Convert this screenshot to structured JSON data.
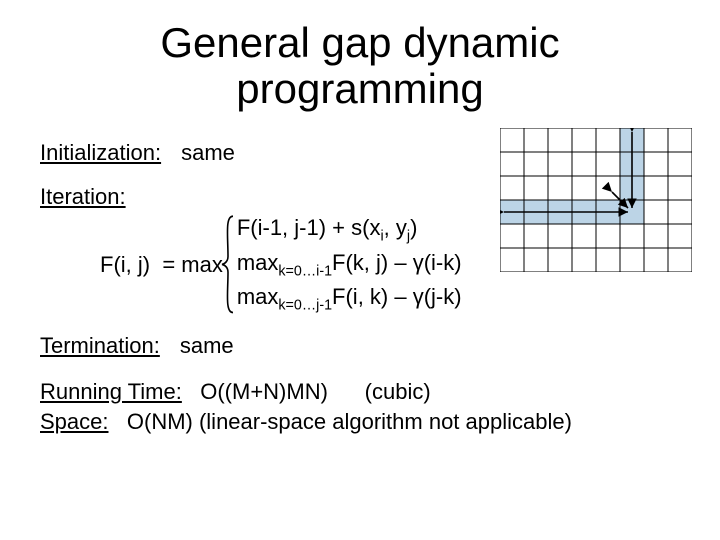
{
  "title": "General gap dynamic programming",
  "initialization": {
    "label": "Initialization:",
    "value": "same"
  },
  "iteration": {
    "label": "Iteration:",
    "lhs": "F(i, j)  = max",
    "cases": {
      "c1": {
        "pre": "F(i-1, j-1) + s(x",
        "sub1": "i",
        "mid": ", y",
        "sub2": "j",
        "post": ")"
      },
      "c2": {
        "pre": "max",
        "sub": "k=0…i-1",
        "mid": "F(k, j) – ",
        "gamma": "γ",
        "post": "(i-k)"
      },
      "c3": {
        "pre": "max",
        "sub": "k=0…j-1",
        "mid": "F(i, k) – ",
        "gamma": "γ",
        "post": "(j-k)"
      }
    }
  },
  "termination": {
    "label": "Termination:",
    "value": "same"
  },
  "complexity": {
    "rt_label": "Running Time:",
    "rt_value": "O((M+N)MN)",
    "rt_note": "(cubic)",
    "sp_label": "Space:",
    "sp_value": "O(NM) (linear-space algorithm not applicable)"
  },
  "figure": {
    "name": "alignment-grid",
    "cols": 8,
    "rows": 6,
    "focus_col": 5,
    "focus_row": 3,
    "shade_color": "#bcd4e6",
    "arrow_color": "#000"
  }
}
